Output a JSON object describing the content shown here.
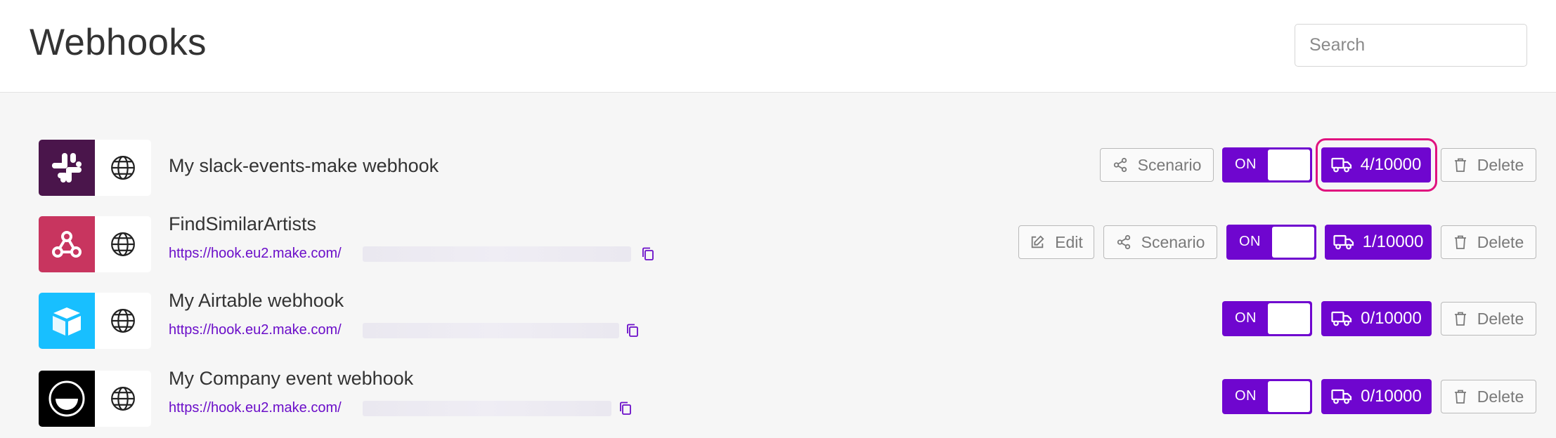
{
  "page": {
    "title": "Webhooks"
  },
  "search": {
    "placeholder": "Search"
  },
  "webhooks": [
    {
      "name": "My slack-events-make webhook",
      "app": "slack",
      "toggle": "ON",
      "ops": "4/10000",
      "scenario": "Scenario",
      "delete": "Delete"
    },
    {
      "name": "FindSimilarArtists",
      "app": "webhooks",
      "url": "https://hook.eu2.make.com/",
      "toggle": "ON",
      "ops": "1/10000",
      "edit": "Edit",
      "scenario": "Scenario",
      "delete": "Delete"
    },
    {
      "name": "My Airtable webhook",
      "app": "airtable",
      "url": "https://hook.eu2.make.com/",
      "toggle": "ON",
      "ops": "0/10000",
      "delete": "Delete"
    },
    {
      "name": "My Company event webhook",
      "app": "company",
      "url": "https://hook.eu2.make.com/",
      "toggle": "ON",
      "ops": "0/10000",
      "delete": "Delete"
    }
  ],
  "colors": {
    "accent": "#6f06cf",
    "highlight": "#e0127f",
    "slack": "#4a154b",
    "webhooks": "#c8355f",
    "airtable": "#18bfff"
  }
}
